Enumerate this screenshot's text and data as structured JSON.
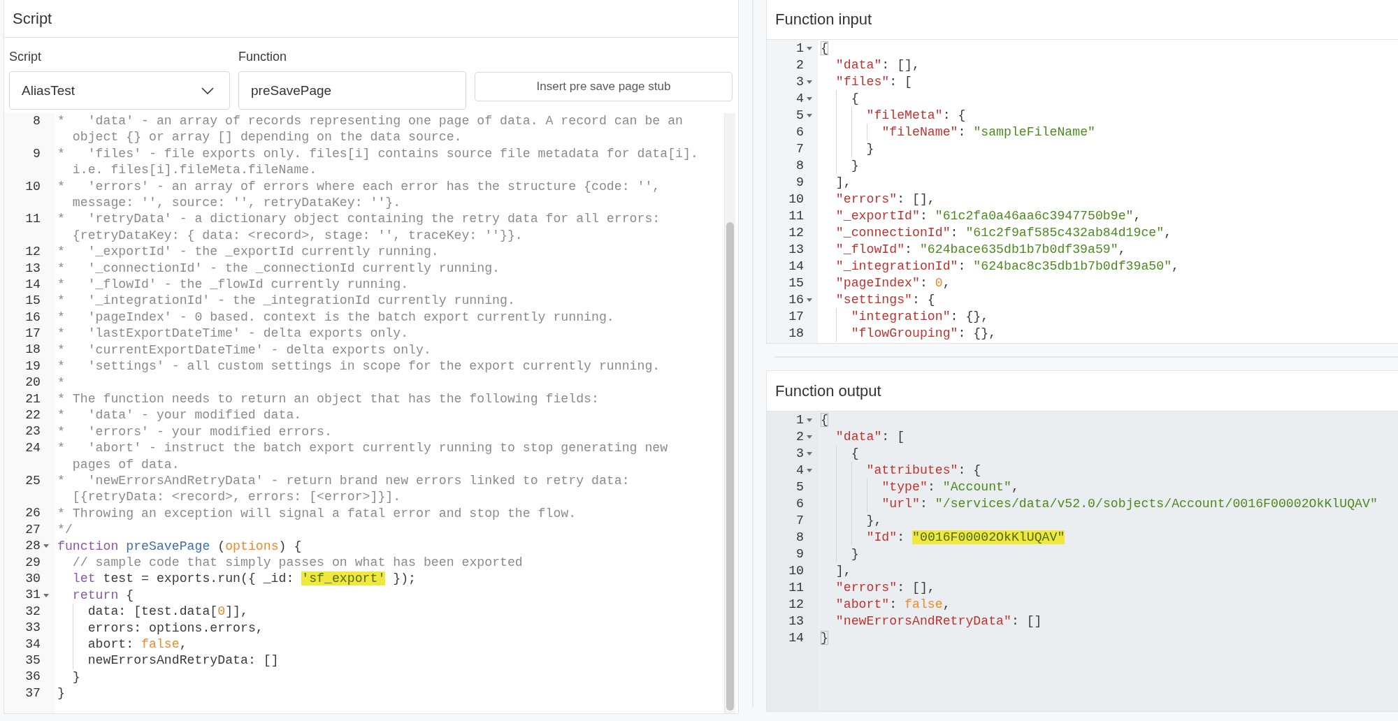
{
  "script_panel": {
    "title": "Script",
    "script_field": {
      "label": "Script",
      "value": "AliasTest"
    },
    "function_field": {
      "label": "Function",
      "value": "preSavePage"
    },
    "stub_button": "Insert pre save page stub",
    "editor": {
      "read_only": false,
      "lines": [
        {
          "number": "8",
          "fold": false,
          "rows": [
            [
              {
                "kind": "comment",
                "text": "*   'data' - an array of records representing one page of data. A record can be an"
              }
            ],
            [
              {
                "kind": "comment",
                "text": "object {} or array [] depending on the data source."
              }
            ]
          ]
        },
        {
          "number": "9",
          "fold": false,
          "rows": [
            [
              {
                "kind": "comment",
                "text": "*   'files' - file exports only. files[i] contains source file metadata for data[i]."
              }
            ],
            [
              {
                "kind": "comment",
                "text": "i.e. files[i].fileMeta.fileName."
              }
            ]
          ]
        },
        {
          "number": "10",
          "fold": false,
          "rows": [
            [
              {
                "kind": "comment",
                "text": "*   'errors' - an array of errors where each error has the structure {code: '',"
              }
            ],
            [
              {
                "kind": "comment",
                "text": "message: '', source: '', retryDataKey: ''}."
              }
            ]
          ]
        },
        {
          "number": "11",
          "fold": false,
          "rows": [
            [
              {
                "kind": "comment",
                "text": "*   'retryData' - a dictionary object containing the retry data for all errors:"
              }
            ],
            [
              {
                "kind": "comment",
                "text": "{retryDataKey: { data: <record>, stage: '', traceKey: ''}}."
              }
            ]
          ]
        },
        {
          "number": "12",
          "fold": false,
          "rows": [
            [
              {
                "kind": "comment",
                "text": "*   '_exportId' - the _exportId currently running."
              }
            ]
          ]
        },
        {
          "number": "13",
          "fold": false,
          "rows": [
            [
              {
                "kind": "comment",
                "text": "*   '_connectionId' - the _connectionId currently running."
              }
            ]
          ]
        },
        {
          "number": "14",
          "fold": false,
          "rows": [
            [
              {
                "kind": "comment",
                "text": "*   '_flowId' - the _flowId currently running."
              }
            ]
          ]
        },
        {
          "number": "15",
          "fold": false,
          "rows": [
            [
              {
                "kind": "comment",
                "text": "*   '_integrationId' - the _integrationId currently running."
              }
            ]
          ]
        },
        {
          "number": "16",
          "fold": false,
          "rows": [
            [
              {
                "kind": "comment",
                "text": "*   'pageIndex' - 0 based. context is the batch export currently running."
              }
            ]
          ]
        },
        {
          "number": "17",
          "fold": false,
          "rows": [
            [
              {
                "kind": "comment",
                "text": "*   'lastExportDateTime' - delta exports only."
              }
            ]
          ]
        },
        {
          "number": "18",
          "fold": false,
          "rows": [
            [
              {
                "kind": "comment",
                "text": "*   'currentExportDateTime' - delta exports only."
              }
            ]
          ]
        },
        {
          "number": "19",
          "fold": false,
          "rows": [
            [
              {
                "kind": "comment",
                "text": "*   'settings' - all custom settings in scope for the export currently running."
              }
            ]
          ]
        },
        {
          "number": "20",
          "fold": false,
          "rows": [
            [
              {
                "kind": "comment",
                "text": "*"
              }
            ]
          ]
        },
        {
          "number": "21",
          "fold": false,
          "rows": [
            [
              {
                "kind": "comment",
                "text": "* The function needs to return an object that has the following fields:"
              }
            ]
          ]
        },
        {
          "number": "22",
          "fold": false,
          "rows": [
            [
              {
                "kind": "comment",
                "text": "*   'data' - your modified data."
              }
            ]
          ]
        },
        {
          "number": "23",
          "fold": false,
          "rows": [
            [
              {
                "kind": "comment",
                "text": "*   'errors' - your modified errors."
              }
            ]
          ]
        },
        {
          "number": "24",
          "fold": false,
          "rows": [
            [
              {
                "kind": "comment",
                "text": "*   'abort' - instruct the batch export currently running to stop generating new"
              }
            ],
            [
              {
                "kind": "comment",
                "text": "pages of data."
              }
            ]
          ]
        },
        {
          "number": "25",
          "fold": false,
          "rows": [
            [
              {
                "kind": "comment",
                "text": "*   'newErrorsAndRetryData' - return brand new errors linked to retry data:"
              }
            ],
            [
              {
                "kind": "comment",
                "text": "[{retryData: <record>, errors: [<error>]}]."
              }
            ]
          ]
        },
        {
          "number": "26",
          "fold": false,
          "rows": [
            [
              {
                "kind": "comment",
                "text": "* Throwing an exception will signal a fatal error and stop the flow."
              }
            ]
          ]
        },
        {
          "number": "27",
          "fold": false,
          "rows": [
            [
              {
                "kind": "comment",
                "text": "*/"
              }
            ]
          ]
        },
        {
          "number": "28",
          "fold": true,
          "rows": [
            [
              {
                "kind": "keyword",
                "text": "function"
              },
              {
                "kind": "plain",
                "text": " "
              },
              {
                "kind": "function",
                "text": "preSavePage"
              },
              {
                "kind": "plain",
                "text": " ("
              },
              {
                "kind": "param",
                "text": "options"
              },
              {
                "kind": "plain",
                "text": ") {"
              }
            ]
          ]
        },
        {
          "number": "29",
          "fold": false,
          "rows": [
            [
              {
                "kind": "comment",
                "text": "  // sample code that simply passes on what has been exported"
              }
            ]
          ]
        },
        {
          "number": "30",
          "fold": false,
          "rows": [
            [
              {
                "kind": "plain",
                "text": "  "
              },
              {
                "kind": "keyword",
                "text": "let"
              },
              {
                "kind": "plain",
                "text": " test = exports.run({ _id: "
              },
              {
                "kind": "highlight",
                "text": "'sf_export'"
              },
              {
                "kind": "plain",
                "text": " });"
              }
            ]
          ]
        },
        {
          "number": "31",
          "fold": true,
          "rows": [
            [
              {
                "kind": "plain",
                "text": "  "
              },
              {
                "kind": "keyword",
                "text": "return"
              },
              {
                "kind": "plain",
                "text": " {"
              }
            ]
          ]
        },
        {
          "number": "32",
          "fold": false,
          "rows": [
            [
              {
                "kind": "plain",
                "text": "    data: [test.data["
              },
              {
                "kind": "number",
                "text": "0"
              },
              {
                "kind": "plain",
                "text": "]],"
              }
            ]
          ]
        },
        {
          "number": "33",
          "fold": false,
          "rows": [
            [
              {
                "kind": "plain",
                "text": "    errors: options.errors,"
              }
            ]
          ]
        },
        {
          "number": "34",
          "fold": false,
          "rows": [
            [
              {
                "kind": "plain",
                "text": "    abort: "
              },
              {
                "kind": "constant",
                "text": "false"
              },
              {
                "kind": "plain",
                "text": ","
              }
            ]
          ]
        },
        {
          "number": "35",
          "fold": false,
          "rows": [
            [
              {
                "kind": "plain",
                "text": "    newErrorsAndRetryData: []"
              }
            ]
          ]
        },
        {
          "number": "36",
          "fold": false,
          "rows": [
            [
              {
                "kind": "plain",
                "text": "  }"
              }
            ]
          ]
        },
        {
          "number": "37",
          "fold": false,
          "rows": [
            [
              {
                "kind": "plain",
                "text": "}"
              }
            ]
          ]
        }
      ]
    }
  },
  "function_input": {
    "title": "Function input",
    "editor": {
      "read_only": false,
      "lines": [
        {
          "number": "1",
          "fold": true,
          "rows": [
            [
              {
                "kind": "matched-bracket",
                "text": "{"
              }
            ]
          ]
        },
        {
          "number": "2",
          "fold": false,
          "rows": [
            [
              {
                "kind": "plain",
                "text": "  "
              },
              {
                "kind": "key",
                "text": "\"data\""
              },
              {
                "kind": "plain",
                "text": ": [],"
              }
            ]
          ]
        },
        {
          "number": "3",
          "fold": true,
          "rows": [
            [
              {
                "kind": "plain",
                "text": "  "
              },
              {
                "kind": "key",
                "text": "\"files\""
              },
              {
                "kind": "plain",
                "text": ": ["
              }
            ]
          ]
        },
        {
          "number": "4",
          "fold": true,
          "rows": [
            [
              {
                "kind": "plain",
                "text": "    {"
              }
            ]
          ]
        },
        {
          "number": "5",
          "fold": true,
          "rows": [
            [
              {
                "kind": "plain",
                "text": "      "
              },
              {
                "kind": "key",
                "text": "\"fileMeta\""
              },
              {
                "kind": "plain",
                "text": ": {"
              }
            ]
          ]
        },
        {
          "number": "6",
          "fold": false,
          "rows": [
            [
              {
                "kind": "plain",
                "text": "        "
              },
              {
                "kind": "key",
                "text": "\"fileName\""
              },
              {
                "kind": "plain",
                "text": ": "
              },
              {
                "kind": "string",
                "text": "\"sampleFileName\""
              }
            ]
          ]
        },
        {
          "number": "7",
          "fold": false,
          "rows": [
            [
              {
                "kind": "plain",
                "text": "      }"
              }
            ]
          ]
        },
        {
          "number": "8",
          "fold": false,
          "rows": [
            [
              {
                "kind": "plain",
                "text": "    }"
              }
            ]
          ]
        },
        {
          "number": "9",
          "fold": false,
          "rows": [
            [
              {
                "kind": "plain",
                "text": "  ],"
              }
            ]
          ]
        },
        {
          "number": "10",
          "fold": false,
          "rows": [
            [
              {
                "kind": "plain",
                "text": "  "
              },
              {
                "kind": "key",
                "text": "\"errors\""
              },
              {
                "kind": "plain",
                "text": ": [],"
              }
            ]
          ]
        },
        {
          "number": "11",
          "fold": false,
          "rows": [
            [
              {
                "kind": "plain",
                "text": "  "
              },
              {
                "kind": "key",
                "text": "\"_exportId\""
              },
              {
                "kind": "plain",
                "text": ": "
              },
              {
                "kind": "string",
                "text": "\"61c2fa0a46aa6c3947750b9e\""
              },
              {
                "kind": "plain",
                "text": ","
              }
            ]
          ]
        },
        {
          "number": "12",
          "fold": false,
          "rows": [
            [
              {
                "kind": "plain",
                "text": "  "
              },
              {
                "kind": "key",
                "text": "\"_connectionId\""
              },
              {
                "kind": "plain",
                "text": ": "
              },
              {
                "kind": "string",
                "text": "\"61c2f9af585c432ab84d19ce\""
              },
              {
                "kind": "plain",
                "text": ","
              }
            ]
          ]
        },
        {
          "number": "13",
          "fold": false,
          "rows": [
            [
              {
                "kind": "plain",
                "text": "  "
              },
              {
                "kind": "key",
                "text": "\"_flowId\""
              },
              {
                "kind": "plain",
                "text": ": "
              },
              {
                "kind": "string",
                "text": "\"624bace635db1b7b0df39a59\""
              },
              {
                "kind": "plain",
                "text": ","
              }
            ]
          ]
        },
        {
          "number": "14",
          "fold": false,
          "rows": [
            [
              {
                "kind": "plain",
                "text": "  "
              },
              {
                "kind": "key",
                "text": "\"_integrationId\""
              },
              {
                "kind": "plain",
                "text": ": "
              },
              {
                "kind": "string",
                "text": "\"624bac8c35db1b7b0df39a50\""
              },
              {
                "kind": "plain",
                "text": ","
              }
            ]
          ]
        },
        {
          "number": "15",
          "fold": false,
          "rows": [
            [
              {
                "kind": "plain",
                "text": "  "
              },
              {
                "kind": "key",
                "text": "\"pageIndex\""
              },
              {
                "kind": "plain",
                "text": ": "
              },
              {
                "kind": "number",
                "text": "0"
              },
              {
                "kind": "plain",
                "text": ","
              }
            ]
          ]
        },
        {
          "number": "16",
          "fold": true,
          "rows": [
            [
              {
                "kind": "plain",
                "text": "  "
              },
              {
                "kind": "key",
                "text": "\"settings\""
              },
              {
                "kind": "plain",
                "text": ": {"
              }
            ]
          ]
        },
        {
          "number": "17",
          "fold": false,
          "rows": [
            [
              {
                "kind": "plain",
                "text": "    "
              },
              {
                "kind": "key",
                "text": "\"integration\""
              },
              {
                "kind": "plain",
                "text": ": {},"
              }
            ]
          ]
        },
        {
          "number": "18",
          "fold": false,
          "rows": [
            [
              {
                "kind": "plain",
                "text": "    "
              },
              {
                "kind": "key",
                "text": "\"flowGrouping\""
              },
              {
                "kind": "plain",
                "text": ": {},"
              }
            ]
          ]
        }
      ]
    }
  },
  "function_output": {
    "title": "Function output",
    "editor": {
      "read_only": true,
      "lines": [
        {
          "number": "1",
          "fold": true,
          "rows": [
            [
              {
                "kind": "matched-bracket",
                "text": "{"
              }
            ]
          ]
        },
        {
          "number": "2",
          "fold": true,
          "rows": [
            [
              {
                "kind": "plain",
                "text": "  "
              },
              {
                "kind": "key",
                "text": "\"data\""
              },
              {
                "kind": "plain",
                "text": ": ["
              }
            ]
          ]
        },
        {
          "number": "3",
          "fold": true,
          "rows": [
            [
              {
                "kind": "plain",
                "text": "    {"
              }
            ]
          ]
        },
        {
          "number": "4",
          "fold": true,
          "rows": [
            [
              {
                "kind": "plain",
                "text": "      "
              },
              {
                "kind": "key",
                "text": "\"attributes\""
              },
              {
                "kind": "plain",
                "text": ": {"
              }
            ]
          ]
        },
        {
          "number": "5",
          "fold": false,
          "rows": [
            [
              {
                "kind": "plain",
                "text": "        "
              },
              {
                "kind": "key",
                "text": "\"type\""
              },
              {
                "kind": "plain",
                "text": ": "
              },
              {
                "kind": "string",
                "text": "\"Account\""
              },
              {
                "kind": "plain",
                "text": ","
              }
            ]
          ]
        },
        {
          "number": "6",
          "fold": false,
          "rows": [
            [
              {
                "kind": "plain",
                "text": "        "
              },
              {
                "kind": "key",
                "text": "\"url\""
              },
              {
                "kind": "plain",
                "text": ": "
              },
              {
                "kind": "string",
                "text": "\"/services/data/v52.0/sobjects/Account/0016F00002OkKlUQAV\""
              }
            ]
          ]
        },
        {
          "number": "7",
          "fold": false,
          "rows": [
            [
              {
                "kind": "plain",
                "text": "      },"
              }
            ]
          ]
        },
        {
          "number": "8",
          "fold": false,
          "rows": [
            [
              {
                "kind": "plain",
                "text": "      "
              },
              {
                "kind": "key",
                "text": "\"Id\""
              },
              {
                "kind": "plain",
                "text": ": "
              },
              {
                "kind": "highlight",
                "text": "\"0016F00002OkKlUQAV\""
              }
            ]
          ]
        },
        {
          "number": "9",
          "fold": false,
          "rows": [
            [
              {
                "kind": "plain",
                "text": "    }"
              }
            ]
          ]
        },
        {
          "number": "10",
          "fold": false,
          "rows": [
            [
              {
                "kind": "plain",
                "text": "  ],"
              }
            ]
          ]
        },
        {
          "number": "11",
          "fold": false,
          "rows": [
            [
              {
                "kind": "plain",
                "text": "  "
              },
              {
                "kind": "key",
                "text": "\"errors\""
              },
              {
                "kind": "plain",
                "text": ": [],"
              }
            ]
          ]
        },
        {
          "number": "12",
          "fold": false,
          "rows": [
            [
              {
                "kind": "plain",
                "text": "  "
              },
              {
                "kind": "key",
                "text": "\"abort\""
              },
              {
                "kind": "plain",
                "text": ": "
              },
              {
                "kind": "constant",
                "text": "false"
              },
              {
                "kind": "plain",
                "text": ","
              }
            ]
          ]
        },
        {
          "number": "13",
          "fold": false,
          "rows": [
            [
              {
                "kind": "plain",
                "text": "  "
              },
              {
                "kind": "key",
                "text": "\"newErrorsAndRetryData\""
              },
              {
                "kind": "plain",
                "text": ": []"
              }
            ]
          ]
        },
        {
          "number": "14",
          "fold": false,
          "rows": [
            [
              {
                "kind": "matched-bracket",
                "text": "}"
              }
            ]
          ]
        }
      ]
    }
  }
}
